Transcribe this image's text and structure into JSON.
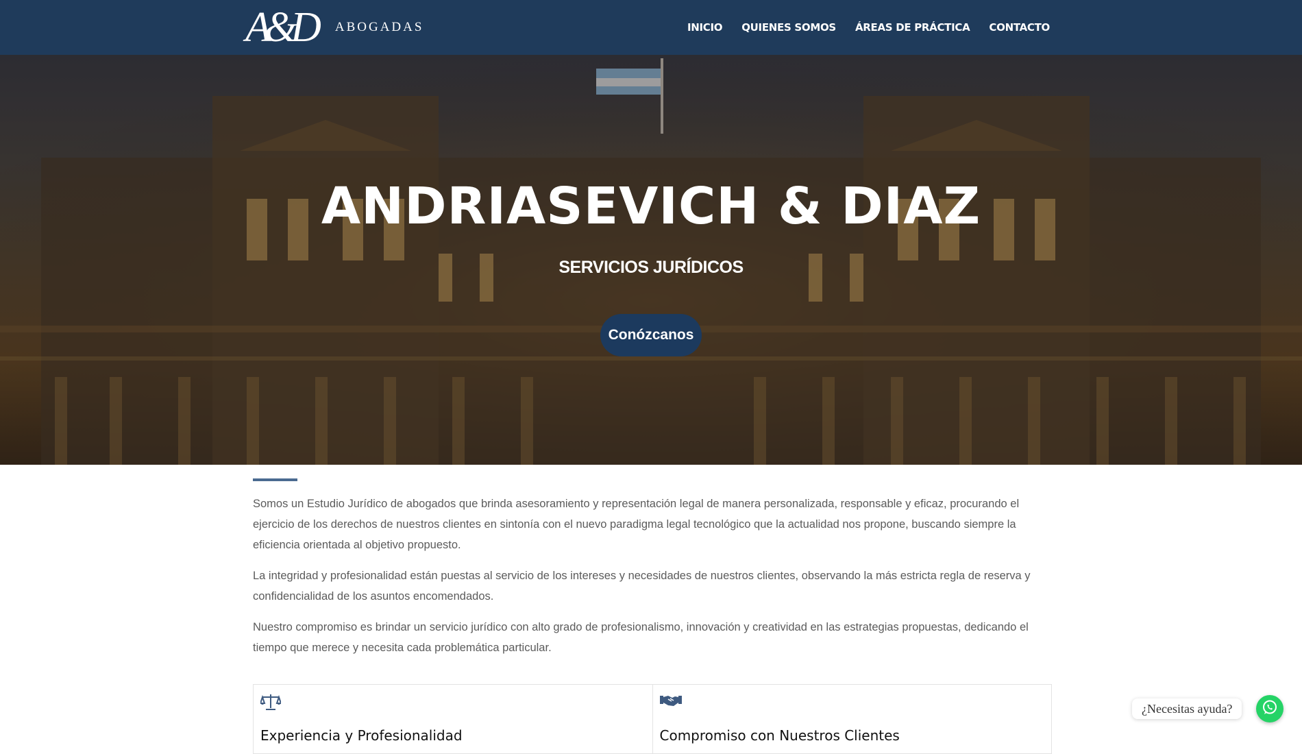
{
  "header": {
    "logo_mark": "A&D",
    "logo_text": "ABOGADAS",
    "nav": [
      "INICIO",
      "QUIENES SOMOS",
      "ÁREAS DE PRÁCTICA",
      "CONTACTO"
    ]
  },
  "hero": {
    "title": "ANDRIASEVICH & DIAZ",
    "subtitle": "SERVICIOS JURÍDICOS",
    "button": "Conózcanos"
  },
  "about": {
    "paragraphs": [
      "Somos un Estudio Jurídico de abogados que brinda asesoramiento y representación legal de manera personalizada, responsable y eficaz, procurando el ejercicio de los derechos de nuestros clientes en sintonía con el nuevo paradigma legal tecnológico que la actualidad nos propone, buscando siempre la eficiencia orientada al objetivo propuesto.",
      "La integridad y profesionalidad están puestas al servicio de los intereses y necesidades de nuestros clientes, observando la más estricta regla de reserva y confidencialidad de los asuntos encomendados.",
      "Nuestro compromiso es brindar un servicio jurídico con alto grado de profesionalismo, innovación y creatividad en las estrategias propuestas, dedicando el tiempo que merece y necesita cada problemática particular."
    ]
  },
  "cards": [
    {
      "icon": "scales-icon",
      "title": "Experiencia y Profesionalidad"
    },
    {
      "icon": "handshake-icon",
      "title": "Compromiso con Nuestros Clientes"
    }
  ],
  "whatsapp": {
    "label": "¿Necesitas ayuda?",
    "icon": "whatsapp-icon"
  },
  "colors": {
    "header": "#1f3b5b",
    "button": "#1c3a5e",
    "accent": "#4a6a90",
    "whatsapp": "#25d366"
  }
}
